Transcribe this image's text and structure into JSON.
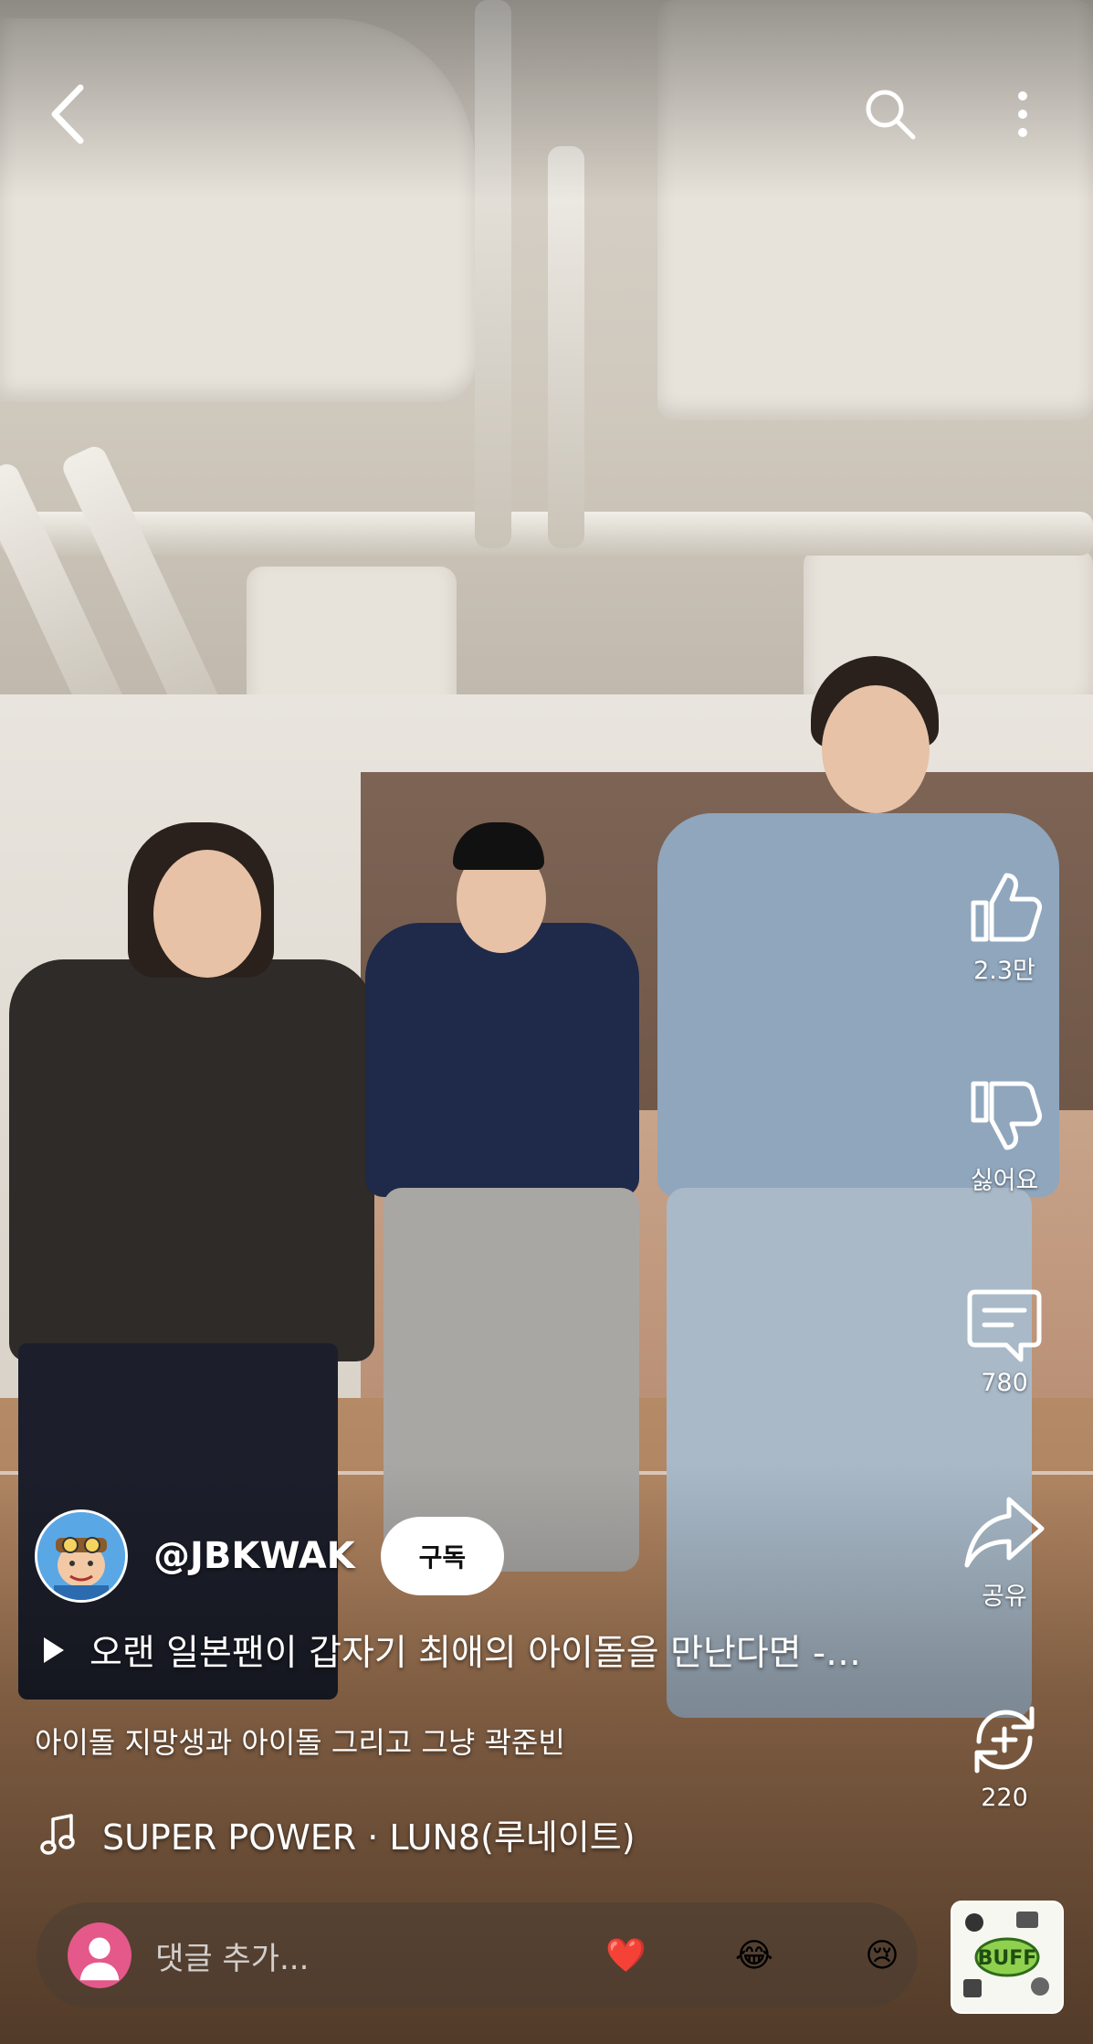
{
  "header": {
    "back_icon": "back-arrow-icon",
    "search_icon": "search-icon",
    "more_icon": "more-vertical-icon"
  },
  "actions": {
    "like": {
      "icon": "thumb-up-icon",
      "label": "2.3만"
    },
    "dislike": {
      "icon": "thumb-down-icon",
      "label": "싫어요"
    },
    "comments": {
      "icon": "comment-icon",
      "label": "780"
    },
    "share": {
      "icon": "share-icon",
      "label": "공유"
    },
    "remix": {
      "icon": "remix-icon",
      "label": "220"
    }
  },
  "channel": {
    "handle": "@JBKWAK",
    "subscribe_label": "구독"
  },
  "video": {
    "title": "오랜 일본팬이 갑자기 최애의 아이돌을 만난다면 -…",
    "description": "아이돌 지망생과 아이돌 그리고 그냥 곽준빈"
  },
  "music": {
    "icon": "music-note-icon",
    "track": "SUPER POWER · LUN8(루네이트)"
  },
  "comment_bar": {
    "placeholder": "댓글 추가...",
    "reactions": [
      "❤️",
      "😂",
      "😢"
    ]
  },
  "colors": {
    "overlay_text": "#ffffff",
    "subscribe_bg": "#ffffff",
    "comment_avatar": "#e4588a"
  }
}
